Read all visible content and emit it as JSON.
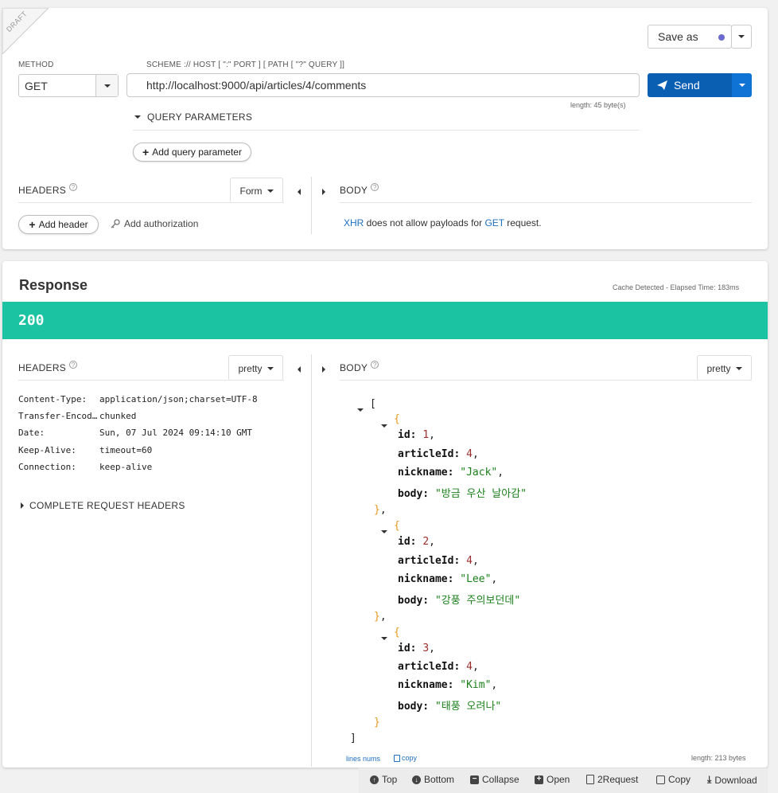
{
  "request": {
    "draft_label": "DRAFT",
    "method_label": "METHOD",
    "method_value": "GET",
    "url_label": "SCHEME :// HOST [ \":\" PORT ] [ PATH [ \"?\" QUERY ]]",
    "url_value": "http://localhost:9000/api/articles/4/comments",
    "url_length": "length: 45 byte(s)",
    "save_as_label": "Save as",
    "send_label": "Send",
    "query_params_label": "QUERY PARAMETERS",
    "add_query_param_label": "Add query parameter",
    "headers_label": "HEADERS",
    "form_label": "Form",
    "add_header_label": "Add header",
    "add_authorization_label": "Add authorization",
    "body_label": "BODY",
    "body_msg_xhr": "XHR",
    "body_msg_mid": " does not allow payloads for ",
    "body_msg_get": "GET",
    "body_msg_end": " request."
  },
  "response": {
    "title": "Response",
    "cache_info": "Cache Detected - Elapsed Time: 183ms",
    "status_code": "200",
    "status_color": "#1bc3a3",
    "headers_label": "HEADERS",
    "headers_format": "pretty",
    "body_label": "BODY",
    "body_format": "pretty",
    "headers": [
      {
        "key": "Content-Type:",
        "value": "application/json;charset=UTF-8"
      },
      {
        "key": "Transfer-Encoding:",
        "value": "chunked"
      },
      {
        "key": "Date:",
        "value": "Sun, 07 Jul 2024 09:14:10 GMT"
      },
      {
        "key": "Keep-Alive:",
        "value": "timeout=60"
      },
      {
        "key": "Connection:",
        "value": "keep-alive"
      }
    ],
    "complete_headers_label": "COMPLETE REQUEST HEADERS",
    "comments": [
      {
        "id": "1",
        "articleId": "4",
        "nickname": "\"Jack\"",
        "body": "\"방금 우산 날아감\""
      },
      {
        "id": "2",
        "articleId": "4",
        "nickname": "\"Lee\"",
        "body": "\"강풍 주의보던데\""
      },
      {
        "id": "3",
        "articleId": "4",
        "nickname": "\"Kim\"",
        "body": "\"태풍 오려나\""
      }
    ],
    "keys": {
      "id": "id:",
      "articleId": "articleId:",
      "nickname": "nickname:",
      "body": "body:"
    },
    "lines_nums_label": "lines nums",
    "copy_label": "copy",
    "body_length": "length: 213 bytes"
  },
  "footer": {
    "top": "Top",
    "bottom": "Bottom",
    "collapse": "Collapse",
    "open": "Open",
    "to_request": "2Request",
    "copy": "Copy",
    "download": "Download"
  }
}
